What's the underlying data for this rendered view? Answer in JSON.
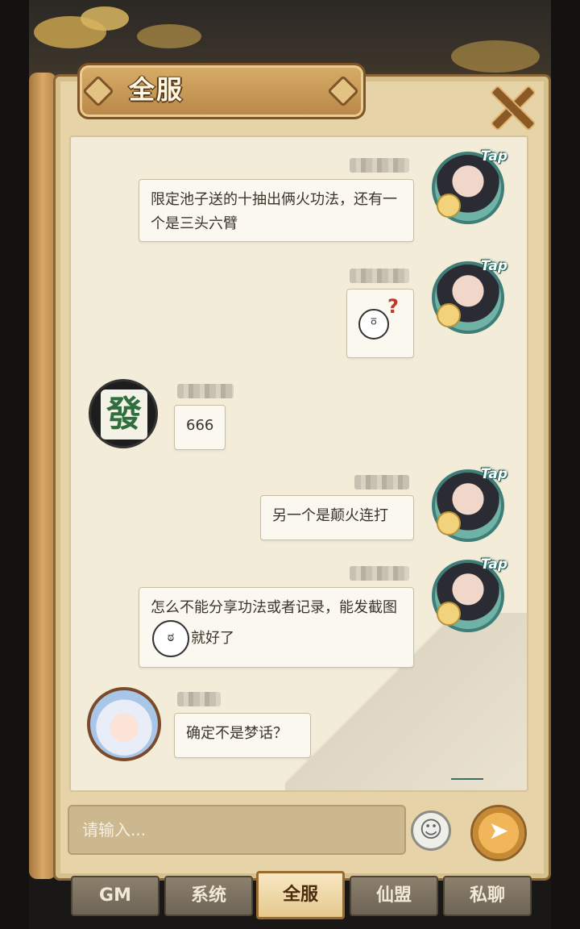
{
  "header": {
    "title": "全服"
  },
  "messages": [
    {
      "side": "right",
      "type": "text",
      "text": "限定池子送的十抽出俩火功法，还有一个是三头六臂"
    },
    {
      "side": "right",
      "type": "sticker",
      "sticker": "confused-face-question-mark"
    },
    {
      "side": "left",
      "type": "text",
      "text": "666",
      "avatar_glyph": "發"
    },
    {
      "side": "right",
      "type": "text",
      "text": "另一个是颠火连打"
    },
    {
      "side": "right",
      "type": "text_with_emoji",
      "text_before": "怎么不能分享功法或者记录，能发截图",
      "text_after": "就好了"
    },
    {
      "side": "left",
      "type": "text",
      "text": "确定不是梦话？"
    }
  ],
  "avatar_badge": "Tap",
  "input": {
    "placeholder": "请输入..."
  },
  "tabs": [
    {
      "label": "GM",
      "active": false
    },
    {
      "label": "系统",
      "active": false
    },
    {
      "label": "全服",
      "active": true
    },
    {
      "label": "仙盟",
      "active": false
    },
    {
      "label": "私聊",
      "active": false
    }
  ],
  "colors": {
    "panel": "#e6d3a7",
    "chat_bg": "#f3ecd9",
    "accent_gold": "#d7ad68",
    "avatar_ring": "#3f7e78"
  }
}
